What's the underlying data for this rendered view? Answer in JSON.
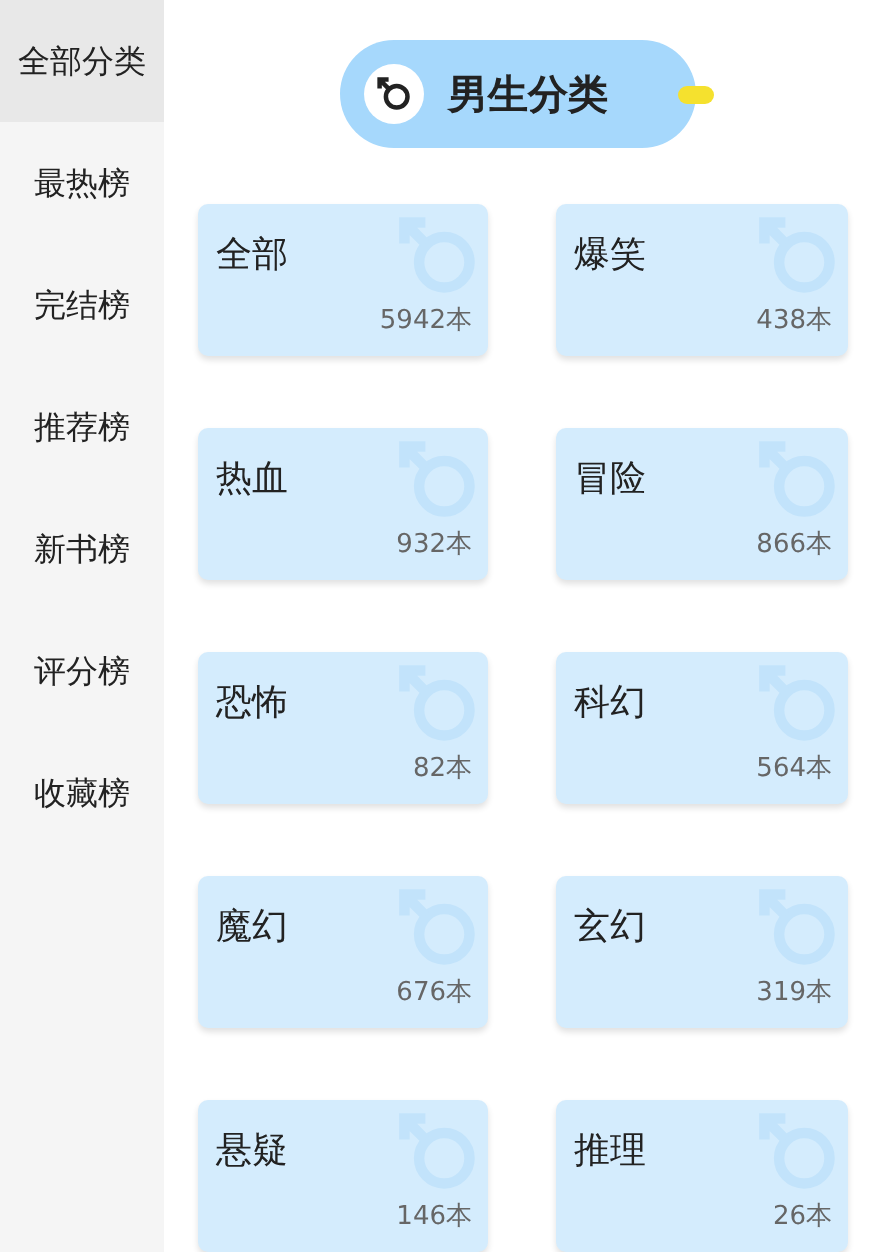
{
  "sidebar": {
    "items": [
      {
        "label": "全部分类",
        "selected": true
      },
      {
        "label": "最热榜",
        "selected": false
      },
      {
        "label": "完结榜",
        "selected": false
      },
      {
        "label": "推荐榜",
        "selected": false
      },
      {
        "label": "新书榜",
        "selected": false
      },
      {
        "label": "评分榜",
        "selected": false
      },
      {
        "label": "收藏榜",
        "selected": false
      }
    ]
  },
  "header": {
    "title": "男生分类"
  },
  "categories": [
    {
      "name": "全部",
      "count": "5942本"
    },
    {
      "name": "爆笑",
      "count": "438本"
    },
    {
      "name": "热血",
      "count": "932本"
    },
    {
      "name": "冒险",
      "count": "866本"
    },
    {
      "name": "恐怖",
      "count": "82本"
    },
    {
      "name": "科幻",
      "count": "564本"
    },
    {
      "name": "魔幻",
      "count": "676本"
    },
    {
      "name": "玄幻",
      "count": "319本"
    },
    {
      "name": "悬疑",
      "count": "146本"
    },
    {
      "name": "推理",
      "count": "26本"
    }
  ]
}
